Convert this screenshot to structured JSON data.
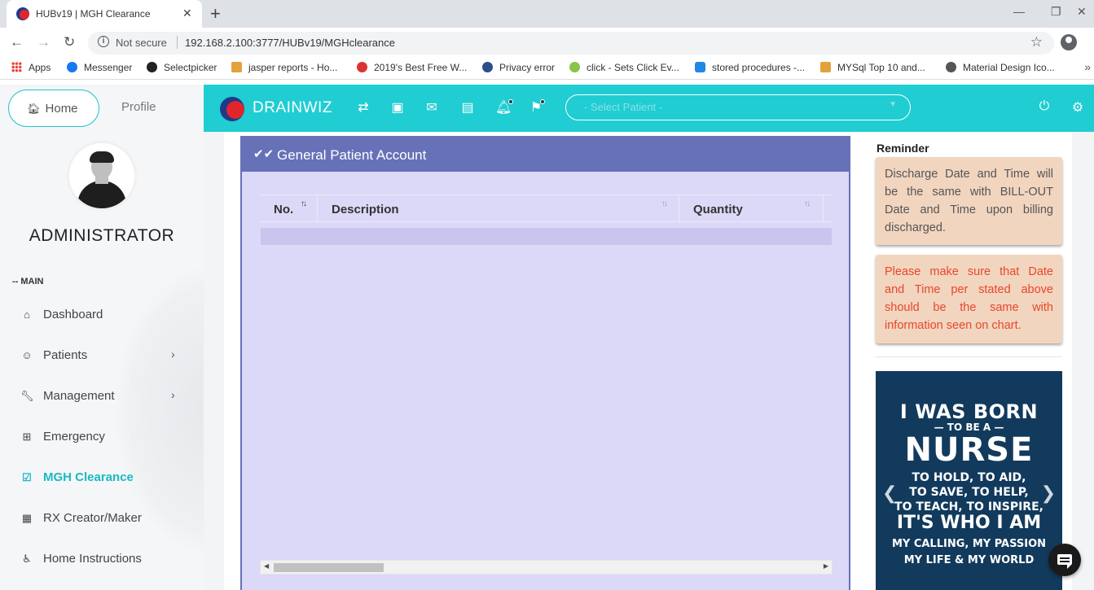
{
  "browser": {
    "tab_title": "HUBv19 | MGH Clearance",
    "tab_close": "✕",
    "new_tab": "+",
    "not_secure": "Not secure",
    "url": "192.168.2.100:3777/HUBv19/MGHclearance",
    "bookmarks": [
      "Apps",
      "Messenger",
      "Selectpicker",
      "jasper reports - Ho...",
      "2019's Best Free W...",
      "Privacy error",
      "click - Sets Click Ev...",
      "stored procedures -...",
      "MYSql Top 10 and...",
      "Material Design Ico..."
    ]
  },
  "sidebar": {
    "home_label": "Home",
    "profile_label": "Profile",
    "user_name": "ADMINISTRATOR",
    "section_label": "-- MAIN",
    "items": [
      {
        "label": "Dashboard",
        "icon": "home-icon"
      },
      {
        "label": "Patients",
        "icon": "face-icon"
      },
      {
        "label": "Management",
        "icon": "wrench-icon"
      },
      {
        "label": "Emergency",
        "icon": "plus-box-icon"
      },
      {
        "label": "MGH Clearance",
        "icon": "checkbox-icon"
      },
      {
        "label": "RX Creator/Maker",
        "icon": "grid-plus-icon"
      },
      {
        "label": "Home Instructions",
        "icon": "accessible-icon"
      }
    ]
  },
  "appbar": {
    "brand": "DRAINWIZ",
    "select_placeholder": "- Select Patient -"
  },
  "panel": {
    "title": "General Patient Account",
    "columns": [
      "No.",
      "Description",
      "Quantity"
    ]
  },
  "reminder": {
    "title": "Reminder",
    "note1": "Discharge Date and Time will be the same with BILL-OUT Date and Time upon billing discharged.",
    "note2": "Please make sure that Date and Time per stated above should be the same with information seen on chart."
  },
  "poster": {
    "line1": "I WAS BORN",
    "line2": "— TO BE A —",
    "line3": "NURSE",
    "line4a": "TO HOLD, TO AID,",
    "line4b": "TO SAVE, TO HELP,",
    "line4c": "TO TEACH, TO INSPIRE,",
    "line5": "IT'S WHO I AM",
    "line6a": "MY CALLING, MY PASSION",
    "line6b": "MY LIFE & MY WORLD"
  },
  "colors": {
    "accent": "#1fcdd3",
    "panel_header": "#6771b8",
    "panel_body": "#dcd8f7",
    "note_bg": "#f2d5bf",
    "warning_text": "#e8472b"
  }
}
